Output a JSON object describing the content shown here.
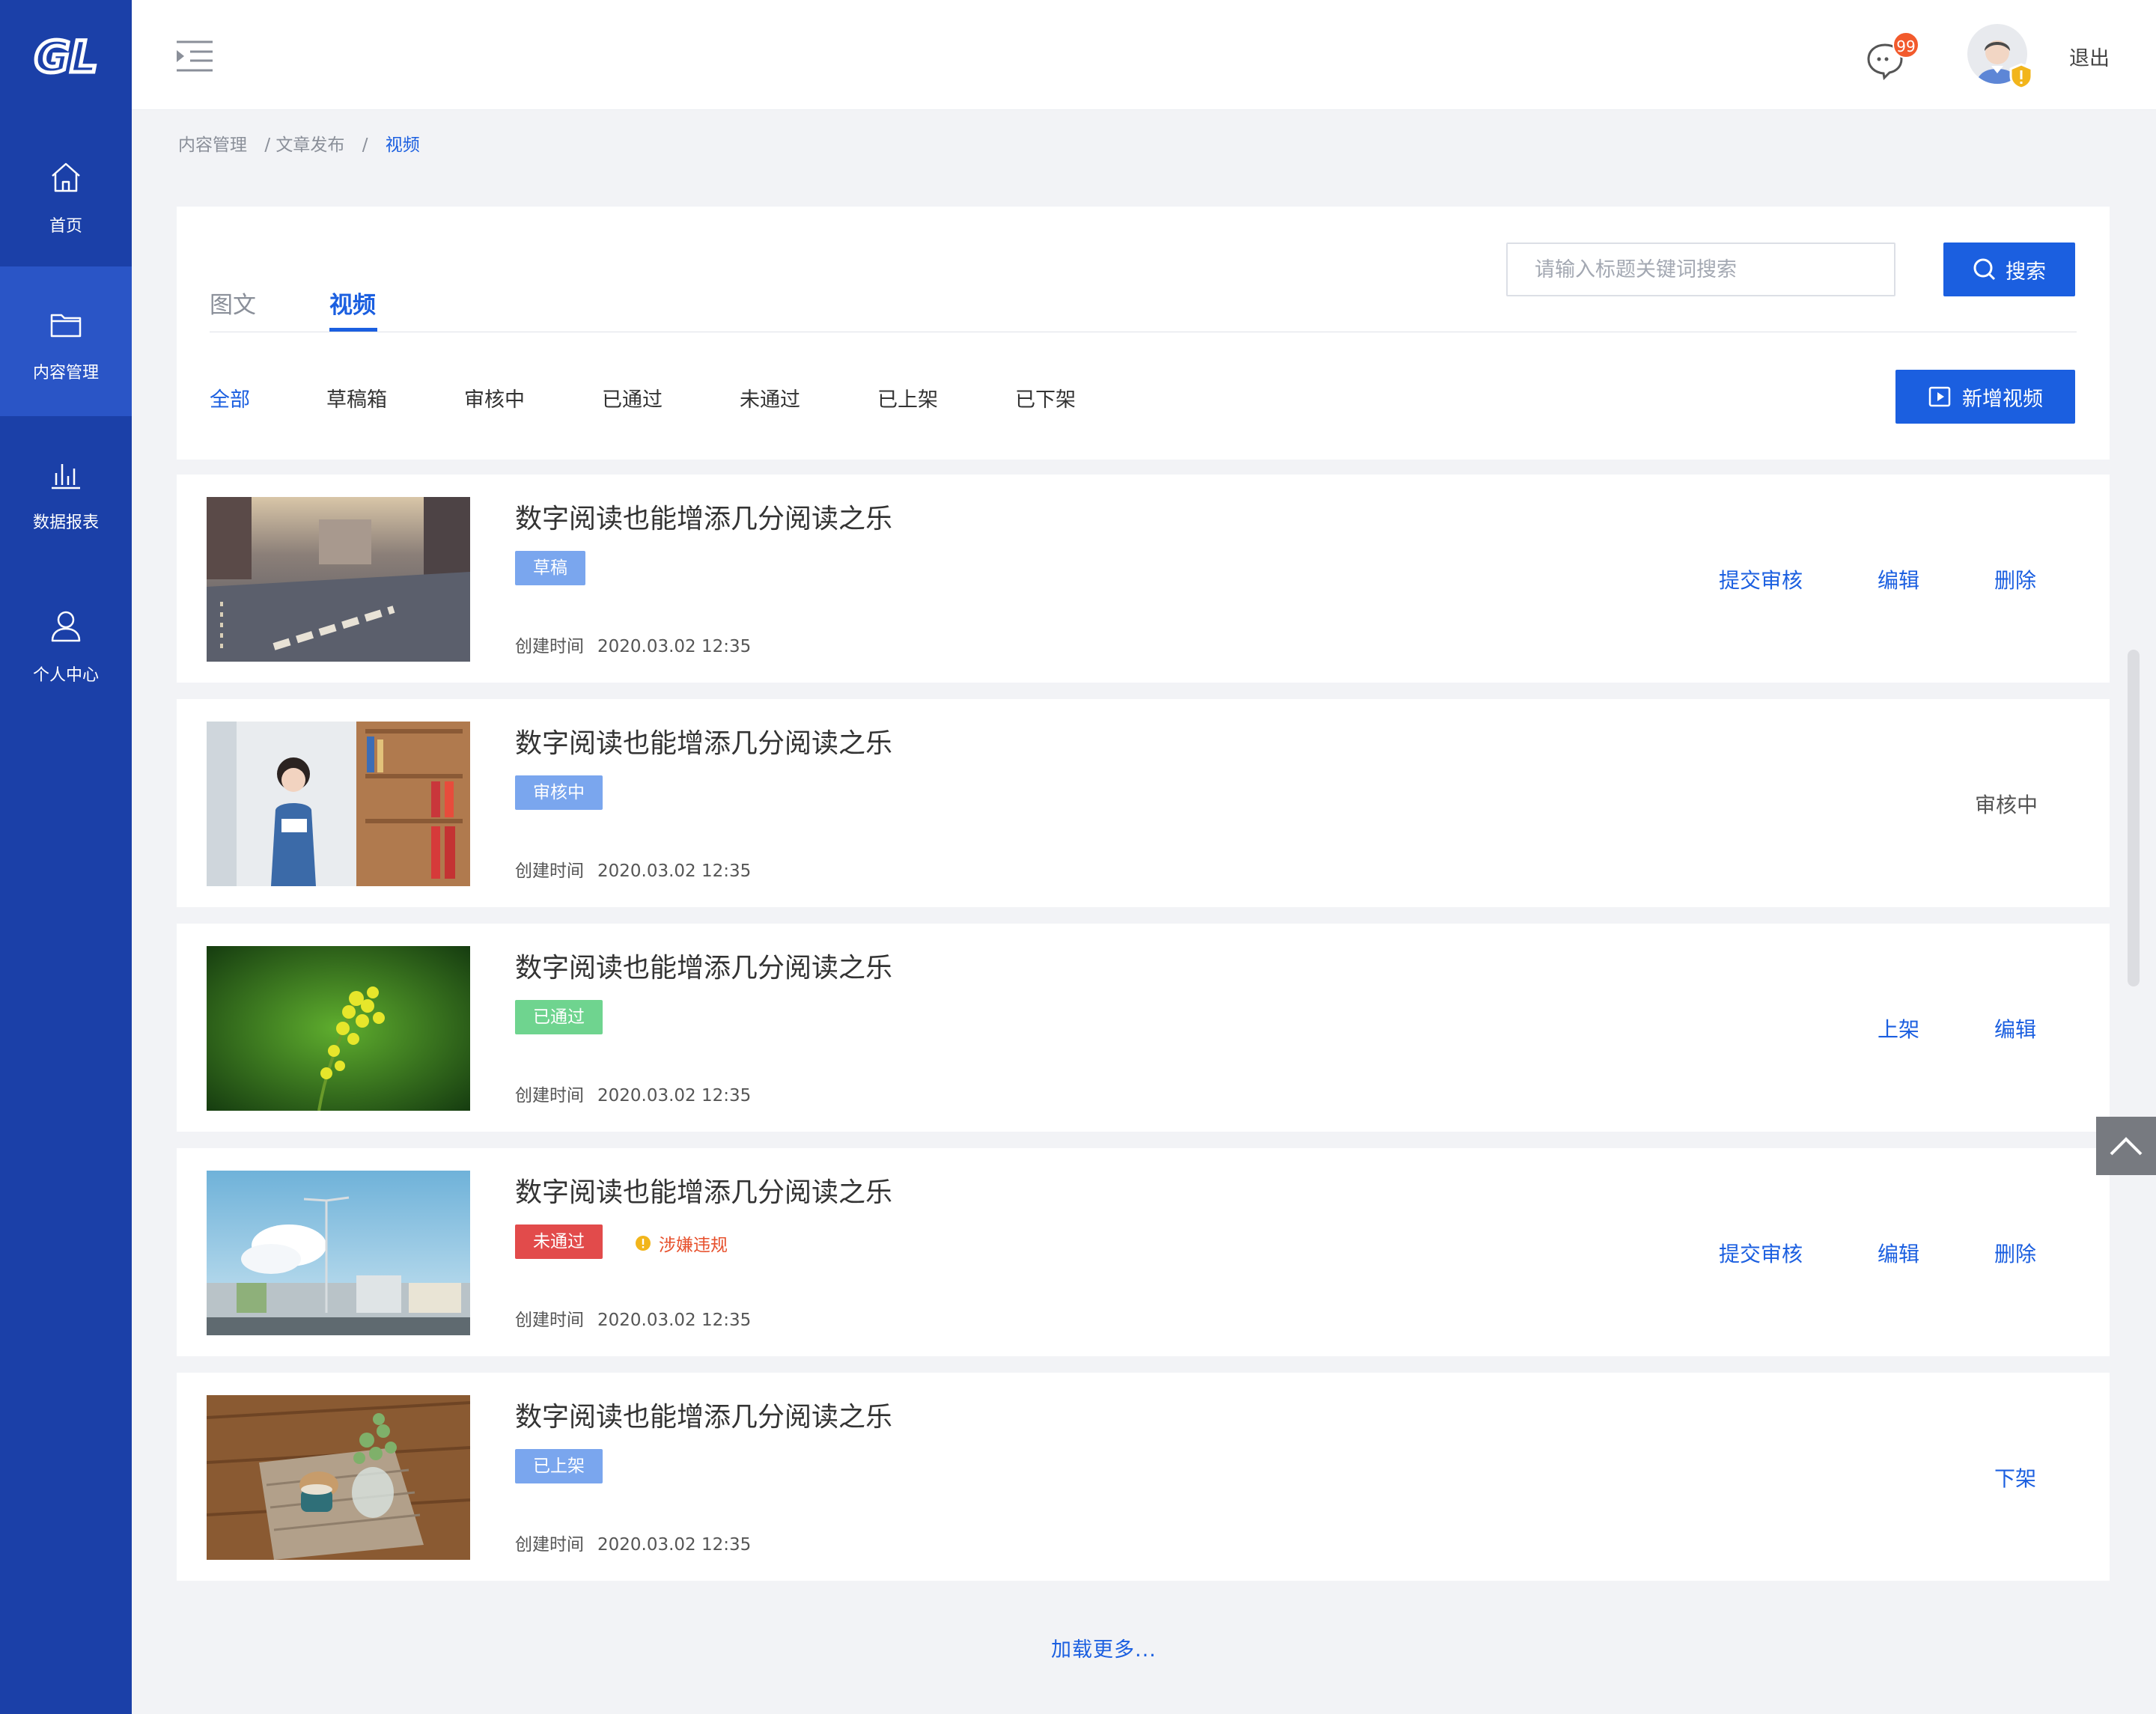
{
  "app": {
    "logo_text": "GL"
  },
  "sidebar": {
    "items": [
      {
        "label": "首页",
        "icon": "home-icon"
      },
      {
        "label": "内容管理",
        "icon": "folder-icon",
        "active": true
      },
      {
        "label": "数据报表",
        "icon": "bar-chart-icon"
      },
      {
        "label": "个人中心",
        "icon": "user-icon"
      }
    ]
  },
  "header": {
    "message_badge": "99",
    "logout_label": "退出"
  },
  "breadcrumb": [
    "内容管理",
    "/ 文章发布",
    "/",
    "视频"
  ],
  "tabs": [
    {
      "label": "图文"
    },
    {
      "label": "视频",
      "active": true
    }
  ],
  "search": {
    "placeholder": "请输入标题关键词搜索",
    "button_label": "搜索"
  },
  "status_filters": [
    "全部",
    "草稿箱",
    "审核中",
    "已通过",
    "未通过",
    "已上架",
    "已下架"
  ],
  "add_button_label": "新增视频",
  "items": [
    {
      "title": "数字阅读也能增添几分阅读之乐",
      "status": "草稿",
      "status_color": "#7aa6ee",
      "created_label": "创建时间",
      "created": "2020.03.02 12:35",
      "actions": [
        "提交审核",
        "编辑",
        "删除"
      ]
    },
    {
      "title": "数字阅读也能增添几分阅读之乐",
      "status": "审核中",
      "status_color": "#7aa6ee",
      "created_label": "创建时间",
      "created": "2020.03.02 12:35",
      "right_status": "审核中"
    },
    {
      "title": "数字阅读也能增添几分阅读之乐",
      "status": "已通过",
      "status_color": "#6fd48f",
      "created_label": "创建时间",
      "created": "2020.03.02 12:35",
      "actions": [
        "上架",
        "编辑"
      ]
    },
    {
      "title": "数字阅读也能增添几分阅读之乐",
      "status": "未通过",
      "status_color": "#e24b4b",
      "warning": "涉嫌违规",
      "created_label": "创建时间",
      "created": "2020.03.02 12:35",
      "actions": [
        "提交审核",
        "编辑",
        "删除"
      ]
    },
    {
      "title": "数字阅读也能增添几分阅读之乐",
      "status": "已上架",
      "status_color": "#7aa6ee",
      "created_label": "创建时间",
      "created": "2020.03.02 12:35",
      "actions": [
        "下架"
      ]
    }
  ],
  "load_more": "加载更多..."
}
